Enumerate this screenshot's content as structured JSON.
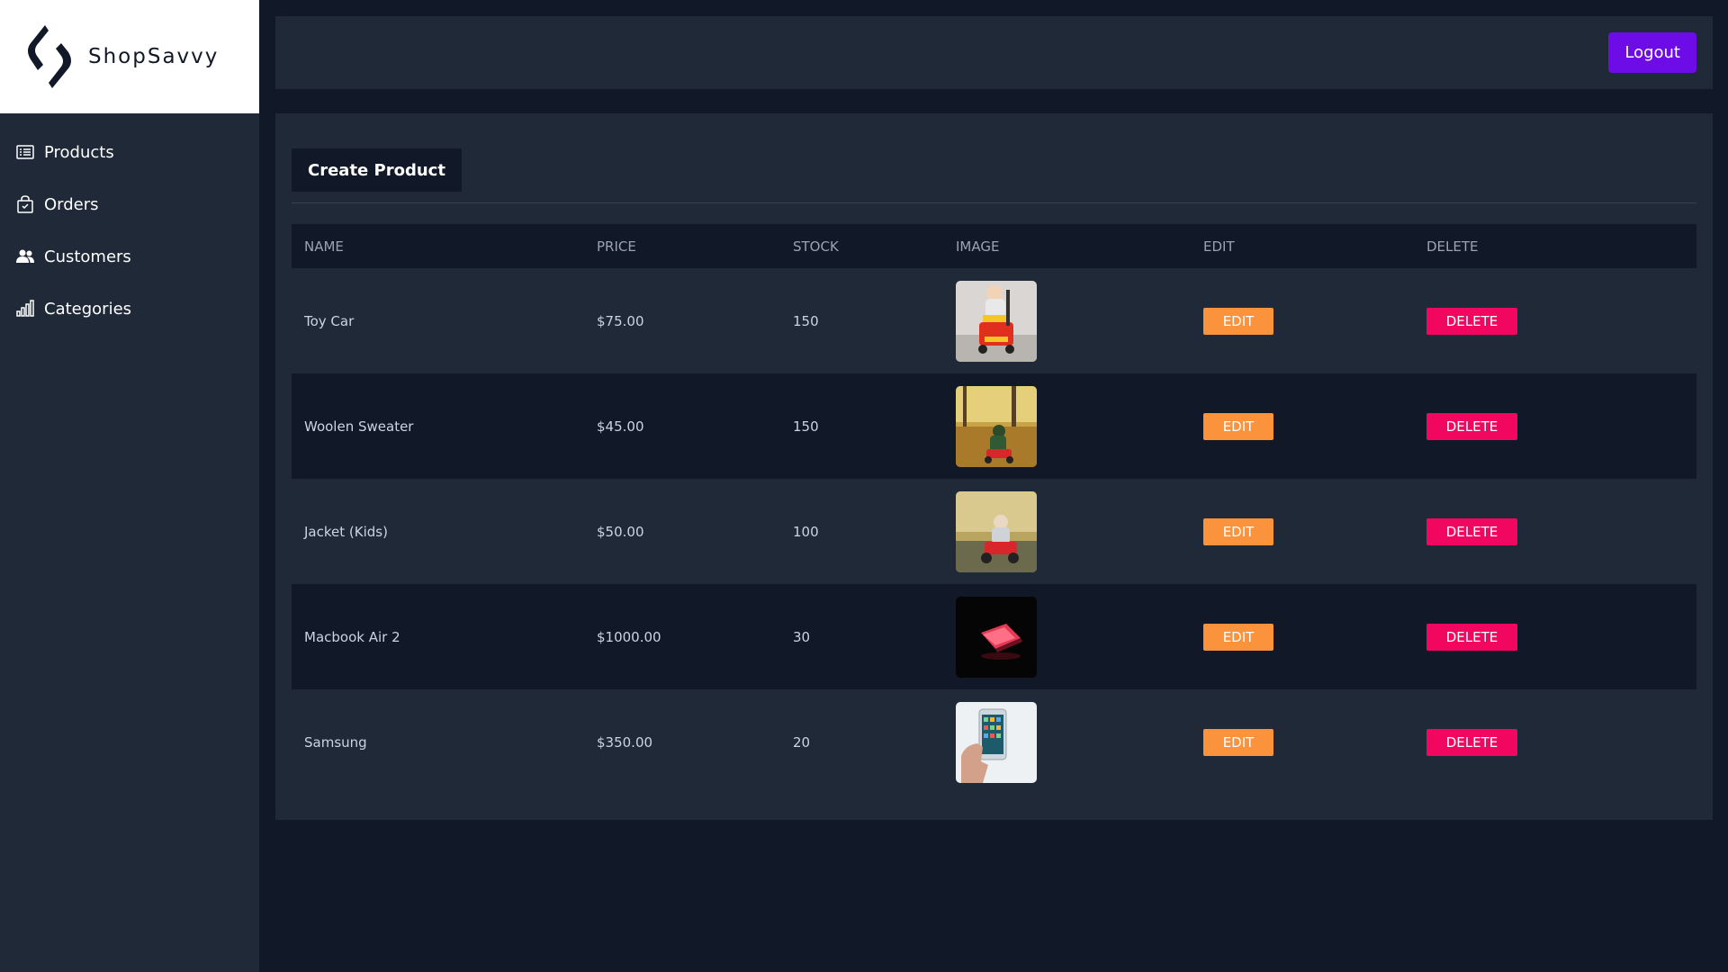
{
  "brand": {
    "name": "ShopSavvy",
    "logo_icon": "shopsavvy-logo-icon"
  },
  "sidebar": {
    "items": [
      {
        "label": "Products",
        "icon": "list-icon"
      },
      {
        "label": "Orders",
        "icon": "shopping-bag-icon"
      },
      {
        "label": "Customers",
        "icon": "users-icon"
      },
      {
        "label": "Categories",
        "icon": "bar-chart-icon"
      }
    ]
  },
  "header": {
    "logout_label": "Logout"
  },
  "main": {
    "create_label": "Create Product",
    "columns": [
      "NAME",
      "PRICE",
      "STOCK",
      "IMAGE",
      "EDIT",
      "DELETE"
    ],
    "rows": [
      {
        "name": "Toy Car",
        "price": "$75.00",
        "stock": "150",
        "image": "toy-car-photo",
        "edit": "EDIT",
        "delete": "DELETE"
      },
      {
        "name": "Woolen Sweater",
        "price": "$45.00",
        "stock": "150",
        "image": "child-autumn-photo",
        "edit": "EDIT",
        "delete": "DELETE"
      },
      {
        "name": "Jacket (Kids)",
        "price": "$50.00",
        "stock": "100",
        "image": "child-red-car-photo",
        "edit": "EDIT",
        "delete": "DELETE"
      },
      {
        "name": "Macbook Air 2",
        "price": "$1000.00",
        "stock": "30",
        "image": "laptop-red-light-photo",
        "edit": "EDIT",
        "delete": "DELETE"
      },
      {
        "name": "Samsung",
        "price": "$350.00",
        "stock": "20",
        "image": "phone-in-hand-photo",
        "edit": "EDIT",
        "delete": "DELETE"
      }
    ]
  },
  "colors": {
    "page_bg": "#111827",
    "panel_bg": "#1f2937",
    "accent": "#6d0ce6",
    "edit": "#fb923c",
    "delete": "#f1075f"
  }
}
